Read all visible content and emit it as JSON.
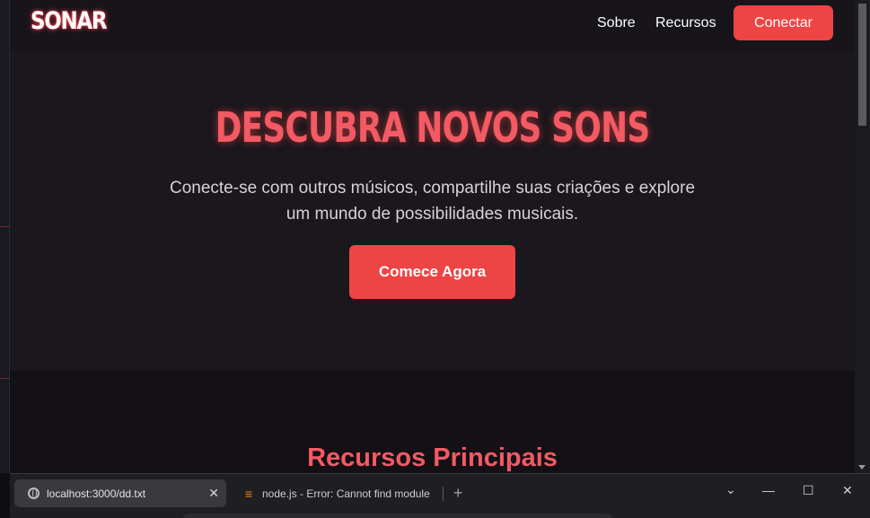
{
  "site": {
    "logo": "SONAR",
    "nav": {
      "sobre": "Sobre",
      "recursos": "Recursos",
      "connect": "Conectar"
    },
    "hero": {
      "title": "DESCUBRA NOVOS SONS",
      "subtitle": "Conecte-se com outros músicos, compartilhe suas criações e explore um mundo de possibilidades musicais.",
      "cta": "Comece Agora"
    },
    "features_title": "Recursos Principais"
  },
  "browser": {
    "tabs": [
      {
        "label": "localhost:3000/dd.txt",
        "icon": "globe-icon",
        "active": true,
        "close": "✕"
      },
      {
        "label": "node.js - Error: Cannot find module",
        "icon": "stackoverflow-icon",
        "active": false
      }
    ],
    "new_tab": "+",
    "controls": {
      "dropdown": "⌄",
      "minimize": "—",
      "maximize": "☐",
      "close": "✕"
    }
  },
  "colors": {
    "accent": "#ef4444",
    "title": "#f25a64",
    "background": "#131116"
  }
}
